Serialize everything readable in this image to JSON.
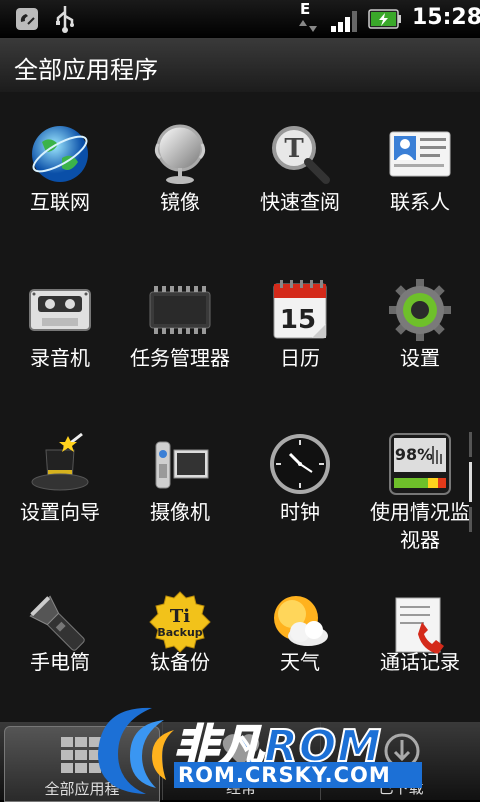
{
  "status": {
    "time": "15:28",
    "network": "E"
  },
  "header": {
    "title": "全部应用程序"
  },
  "apps": [
    {
      "label": "互联网"
    },
    {
      "label": "镜像"
    },
    {
      "label": "快速查阅"
    },
    {
      "label": "联系人"
    },
    {
      "label": "录音机"
    },
    {
      "label": "任务管理器"
    },
    {
      "label": "日历"
    },
    {
      "label": "设置"
    },
    {
      "label": "设置向导"
    },
    {
      "label": "摄像机"
    },
    {
      "label": "时钟"
    },
    {
      "label": "使用情况监视器"
    },
    {
      "label": "手电筒"
    },
    {
      "label": "钛备份"
    },
    {
      "label": "天气"
    },
    {
      "label": "通话记录"
    }
  ],
  "icon_text": {
    "calendar_day": "15",
    "usage_percent": "98%",
    "ti": "Ti",
    "backup": "Backup"
  },
  "tabs": [
    {
      "label": "全部应用程"
    },
    {
      "label": "经常"
    },
    {
      "label": "已下载"
    }
  ],
  "watermark": {
    "brand": "非凡ROM",
    "url": "ROM.CRSKY.COM"
  },
  "colors": {
    "accent": "#6ec02a",
    "watermark_blue": "#1c70d6"
  }
}
